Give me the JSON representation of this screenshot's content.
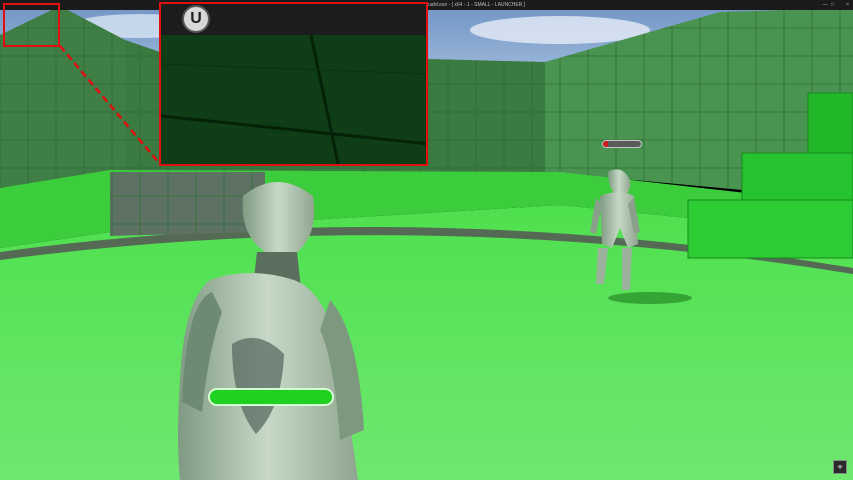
{
  "window": {
    "title": "uafd.exe - [ x64 - 1 - SMALL - LAUNCHER ]",
    "controls": "— □",
    "close_label": "×"
  },
  "hud": {
    "player_health": 1.0,
    "enemy_health": 0.12,
    "player_bar_color": "#1fd21f",
    "enemy_bar_color": "#c81e1e"
  },
  "zoom_inset": {
    "logo_icon": "unreal-engine-logo",
    "logo_glyph": "U",
    "border_color": "#e01010"
  },
  "corner_button": {
    "icon": "screenshot-icon",
    "glyph": "⌖"
  }
}
